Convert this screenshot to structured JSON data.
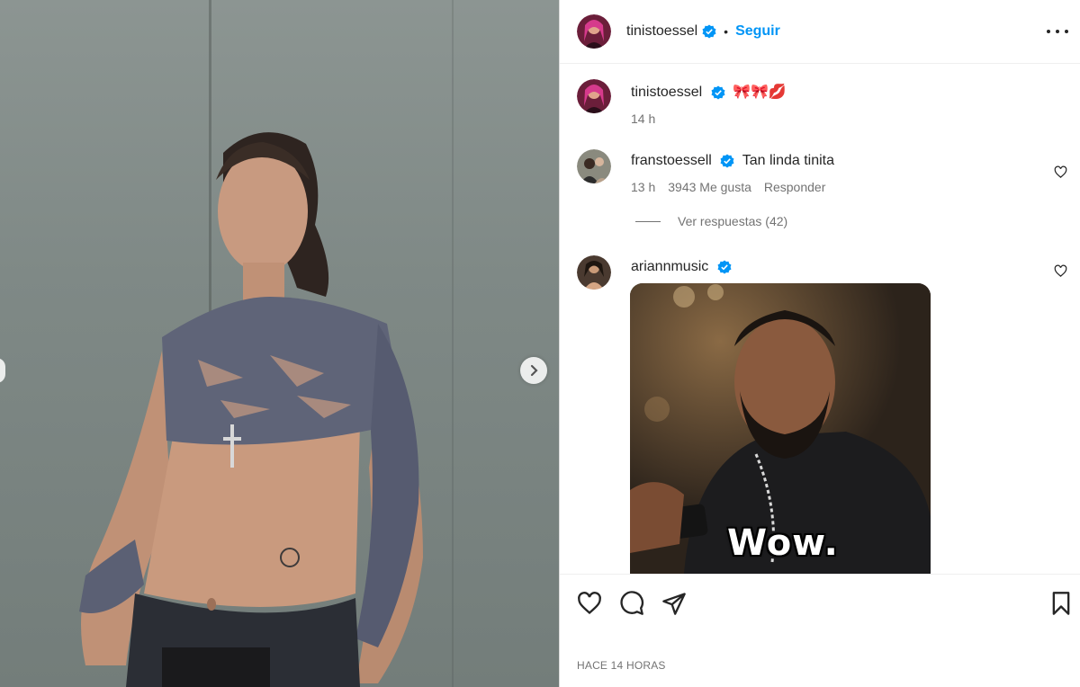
{
  "post": {
    "author": "tinistoessel",
    "follow_label": "Seguir",
    "caption_emojis": "🎀🎀💋",
    "caption_time": "14 h",
    "posted_ago": "HACE 14 HORAS"
  },
  "comments": [
    {
      "user": "franstoessell",
      "text": "Tan linda tinita",
      "time": "13 h",
      "likes": "3943 Me gusta",
      "reply_label": "Responder",
      "view_replies": "Ver respuestas (42)"
    },
    {
      "user": "ariannmusic",
      "gif_caption": "Wow."
    }
  ],
  "icons": {
    "verified": "verified-badge-icon",
    "more": "more-options-icon",
    "like": "heart-icon",
    "comment": "comment-icon",
    "share": "share-icon",
    "save": "bookmark-icon",
    "next": "chevron-right-icon"
  },
  "colors": {
    "accent": "#0095f6",
    "text": "#262626",
    "secondary": "#737373",
    "verified": "#0095f6"
  }
}
